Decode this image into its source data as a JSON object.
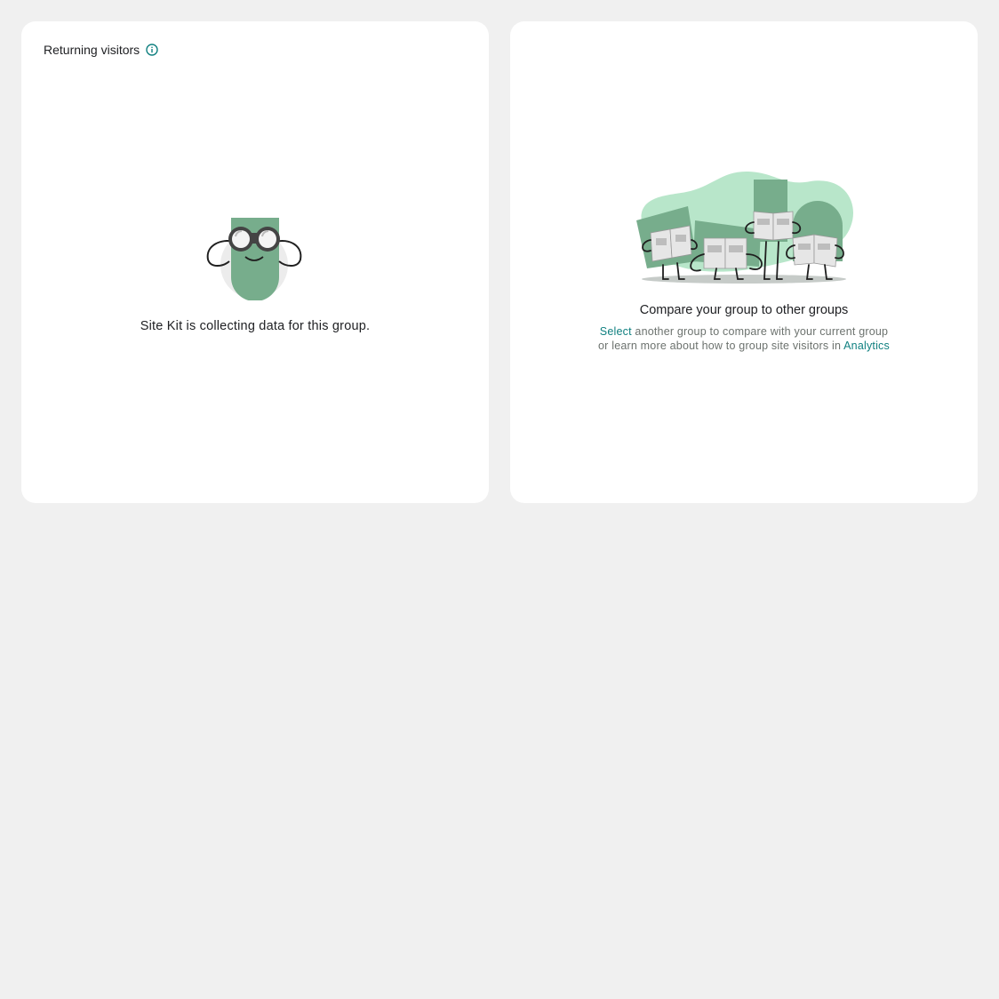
{
  "returning_card": {
    "title": "Returning visitors",
    "info_icon": "info-icon",
    "illustration": "binoculars-character",
    "message": "Site Kit is collecting data for this group."
  },
  "compare_card": {
    "illustration": "people-reading-newspapers",
    "title": "Compare your group to other groups",
    "select_link": "Select",
    "desc_part1": " another group to compare with your current group",
    "desc_part2": "or learn more about how to group site visitors in ",
    "analytics_link": "Analytics"
  },
  "colors": {
    "background": "#f0f0f0",
    "card": "#ffffff",
    "accent_green": "#77ad8c",
    "light_green": "#b8e6ca",
    "link_teal": "#108080"
  }
}
